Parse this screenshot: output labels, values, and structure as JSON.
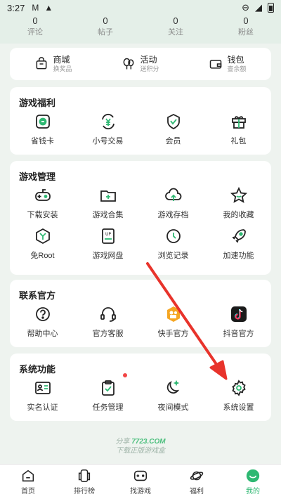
{
  "status_bar": {
    "time": "3:27"
  },
  "stats": [
    {
      "value": "0",
      "label": "评论"
    },
    {
      "value": "0",
      "label": "帖子"
    },
    {
      "value": "0",
      "label": "关注"
    },
    {
      "value": "0",
      "label": "粉丝"
    }
  ],
  "quick_links": [
    {
      "title": "商城",
      "subtitle": "换奖品",
      "icon": "shopping-bag-icon"
    },
    {
      "title": "活动",
      "subtitle": "送积分",
      "icon": "balloon-icon"
    },
    {
      "title": "钱包",
      "subtitle": "查余额",
      "icon": "wallet-icon"
    }
  ],
  "sections": {
    "welfare": {
      "title": "游戏福利",
      "items": [
        {
          "label": "省钱卡",
          "icon": "coupon-icon"
        },
        {
          "label": "小号交易",
          "icon": "yen-exchange-icon"
        },
        {
          "label": "会员",
          "icon": "vip-shield-icon"
        },
        {
          "label": "礼包",
          "icon": "gift-icon"
        }
      ]
    },
    "manage": {
      "title": "游戏管理",
      "items": [
        {
          "label": "下载安装",
          "icon": "gamepad-icon"
        },
        {
          "label": "游戏合集",
          "icon": "folder-plus-icon"
        },
        {
          "label": "游戏存档",
          "icon": "cloud-upload-icon"
        },
        {
          "label": "我的收藏",
          "icon": "star-icon"
        },
        {
          "label": "免Root",
          "icon": "hexagon-y-icon"
        },
        {
          "label": "游戏网盘",
          "icon": "up-disk-icon"
        },
        {
          "label": "浏览记录",
          "icon": "clock-icon"
        },
        {
          "label": "加速功能",
          "icon": "rocket-icon"
        }
      ]
    },
    "official": {
      "title": "联系官方",
      "items": [
        {
          "label": "帮助中心",
          "icon": "help-icon"
        },
        {
          "label": "官方客服",
          "icon": "headset-icon"
        },
        {
          "label": "快手官方",
          "icon": "kuaishou-icon"
        },
        {
          "label": "抖音官方",
          "icon": "douyin-icon"
        }
      ]
    },
    "system": {
      "title": "系统功能",
      "items": [
        {
          "label": "实名认证",
          "icon": "id-card-icon"
        },
        {
          "label": "任务管理",
          "icon": "clipboard-check-icon"
        },
        {
          "label": "夜间模式",
          "icon": "moon-icon"
        },
        {
          "label": "系统设置",
          "icon": "gear-icon"
        }
      ]
    }
  },
  "share": {
    "prefix": "分享",
    "brand": "7723.COM",
    "tagline": "下载正版游戏盒"
  },
  "tabbar": [
    {
      "label": "首页",
      "icon": "home-icon"
    },
    {
      "label": "排行榜",
      "icon": "ranking-icon"
    },
    {
      "label": "找游戏",
      "icon": "game-controller-icon"
    },
    {
      "label": "福利",
      "icon": "planet-icon"
    },
    {
      "label": "我的",
      "icon": "profile-smile-icon"
    }
  ],
  "colors": {
    "accent": "#2eb872",
    "annotation_arrow": "#e8332b",
    "background": "#eef3ef"
  }
}
